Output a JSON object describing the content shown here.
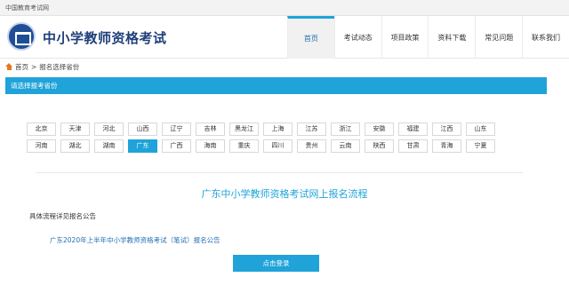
{
  "topbar": {
    "site_name": "中国教育考试网"
  },
  "header": {
    "title": "中小学教师资格考试",
    "nav": [
      {
        "label": "首页",
        "active": true
      },
      {
        "label": "考试动态",
        "active": false
      },
      {
        "label": "项目政策",
        "active": false
      },
      {
        "label": "资料下载",
        "active": false
      },
      {
        "label": "常见问题",
        "active": false
      },
      {
        "label": "联系我们",
        "active": false
      }
    ]
  },
  "breadcrumb": {
    "home": "首页",
    "separator": ">",
    "current": "报名选择省份"
  },
  "section": {
    "title": "请选择报考省份"
  },
  "provinces": {
    "row1": [
      "北京",
      "天津",
      "河北",
      "山西",
      "辽宁",
      "吉林",
      "黑龙江",
      "上海",
      "江苏",
      "浙江",
      "安徽",
      "福建",
      "江西",
      "山东"
    ],
    "row2": [
      "河南",
      "湖北",
      "湖南",
      "广东",
      "广西",
      "海南",
      "重庆",
      "四川",
      "贵州",
      "云南",
      "陕西",
      "甘肃",
      "青海",
      "宁夏"
    ],
    "selected": "广东"
  },
  "flow": {
    "title": "广东中小学教师资格考试网上报名流程",
    "detail_label": "具体流程详见报名公告",
    "notice_link": "广东2020年上半年中小学教师资格考试（笔试）报名公告",
    "login_button": "点击登录"
  },
  "colors": {
    "accent": "#1fa3d9",
    "title_blue": "#1f3f7a",
    "link_blue": "#1f6fb0",
    "home_icon": "#e37a1e"
  }
}
